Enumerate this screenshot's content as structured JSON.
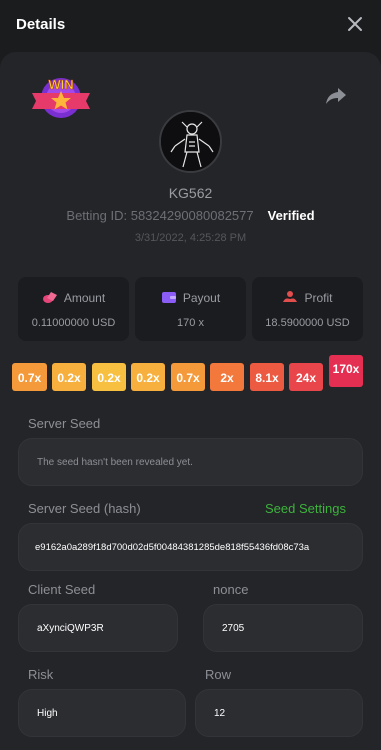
{
  "header": {
    "title": "Details"
  },
  "icons": {
    "close": "close-icon",
    "share": "share-icon",
    "win_badge": "win-badge-icon",
    "avatar": "avatar-image"
  },
  "user": {
    "name": "KG562",
    "betting_id": "Betting ID: 58324290080082577",
    "verified": "Verified",
    "date": "3/31/2022, 4:25:28 PM"
  },
  "stats": [
    {
      "label": "Amount",
      "value": "0.11000000 USD",
      "icon": "coins-icon",
      "icon_color": "#e6457a"
    },
    {
      "label": "Payout",
      "value": "170 x",
      "icon": "wallet-icon",
      "icon_color": "#8b5cf6"
    },
    {
      "label": "Profit",
      "value": "18.5900000 USD",
      "icon": "profit-icon",
      "icon_color": "#e24d4d"
    }
  ],
  "multipliers": [
    {
      "label": "0.7x",
      "color": "#f59a3b"
    },
    {
      "label": "0.2x",
      "color": "#f7b03d"
    },
    {
      "label": "0.2x",
      "color": "#f8c040"
    },
    {
      "label": "0.2x",
      "color": "#f7b03d"
    },
    {
      "label": "0.7x",
      "color": "#f59a3b"
    },
    {
      "label": "2x",
      "color": "#f2783c"
    },
    {
      "label": "8.1x",
      "color": "#ec5a42"
    },
    {
      "label": "24x",
      "color": "#e8464a"
    },
    {
      "label": "170x",
      "color": "#e42f52"
    }
  ],
  "fields": {
    "server_seed": {
      "label": "Server Seed",
      "value": "The seed hasn't been revealed yet."
    },
    "server_seed_hash": {
      "label": "Server Seed (hash)",
      "link": "Seed Settings",
      "value": "e9162a0a289f18d700d02d5f00484381285de818f55436fd08c73a"
    },
    "client_seed": {
      "label": "Client Seed",
      "value": "aXynciQWP3R"
    },
    "nonce": {
      "label": "nonce",
      "value": "2705"
    },
    "risk": {
      "label": "Risk",
      "value": "High"
    },
    "row": {
      "label": "Row",
      "value": "12"
    }
  },
  "colors": {
    "accent_green": "#3cb33c",
    "card": "#242528",
    "background": "#1b1c1e"
  }
}
